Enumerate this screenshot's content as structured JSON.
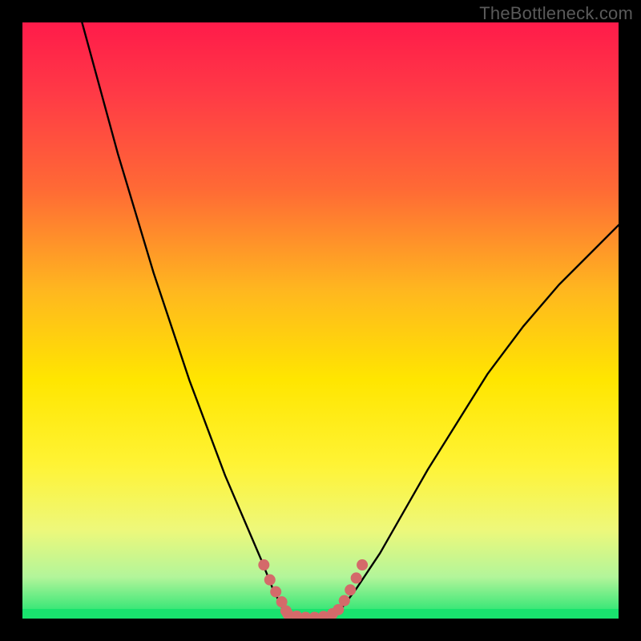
{
  "watermark": "TheBottleneck.com",
  "colors": {
    "frame": "#000000",
    "curve": "#000000",
    "highlight": "#d46a6a",
    "green_band": "#19e36e"
  },
  "chart_data": {
    "type": "line",
    "title": "",
    "xlabel": "",
    "ylabel": "",
    "xlim": [
      0,
      100
    ],
    "ylim": [
      0,
      100
    ],
    "gradient_stops": [
      {
        "offset": 0.0,
        "color": "#ff1b4a"
      },
      {
        "offset": 0.12,
        "color": "#ff3a46"
      },
      {
        "offset": 0.28,
        "color": "#ff6a35"
      },
      {
        "offset": 0.45,
        "color": "#ffb71f"
      },
      {
        "offset": 0.6,
        "color": "#ffe600"
      },
      {
        "offset": 0.74,
        "color": "#fff334"
      },
      {
        "offset": 0.85,
        "color": "#eef87a"
      },
      {
        "offset": 0.93,
        "color": "#b3f59a"
      },
      {
        "offset": 1.0,
        "color": "#19e36e"
      }
    ],
    "series": [
      {
        "name": "left-branch",
        "x": [
          10,
          13,
          16,
          19,
          22,
          25,
          28,
          31,
          34,
          37,
          40,
          42,
          44
        ],
        "y": [
          100,
          89,
          78,
          68,
          58,
          49,
          40,
          32,
          24,
          17,
          10,
          5,
          1
        ]
      },
      {
        "name": "floor",
        "x": [
          44,
          47,
          50,
          53
        ],
        "y": [
          1,
          0,
          0,
          1
        ]
      },
      {
        "name": "right-branch",
        "x": [
          53,
          56,
          60,
          64,
          68,
          73,
          78,
          84,
          90,
          96,
          100
        ],
        "y": [
          1,
          5,
          11,
          18,
          25,
          33,
          41,
          49,
          56,
          62,
          66
        ]
      }
    ],
    "highlight_segments": [
      {
        "name": "left-near-min",
        "x": [
          40.5,
          41.5,
          42.5,
          43.5,
          44.2
        ],
        "y": [
          9,
          6.5,
          4.5,
          2.8,
          1.3
        ]
      },
      {
        "name": "floor-dots",
        "x": [
          44.5,
          46,
          47.5,
          49,
          50.5,
          52
        ],
        "y": [
          0.8,
          0.4,
          0.2,
          0.2,
          0.35,
          0.8
        ]
      },
      {
        "name": "right-near-min",
        "x": [
          53,
          54,
          55,
          56,
          57
        ],
        "y": [
          1.5,
          3,
          4.8,
          6.8,
          9
        ]
      }
    ]
  }
}
